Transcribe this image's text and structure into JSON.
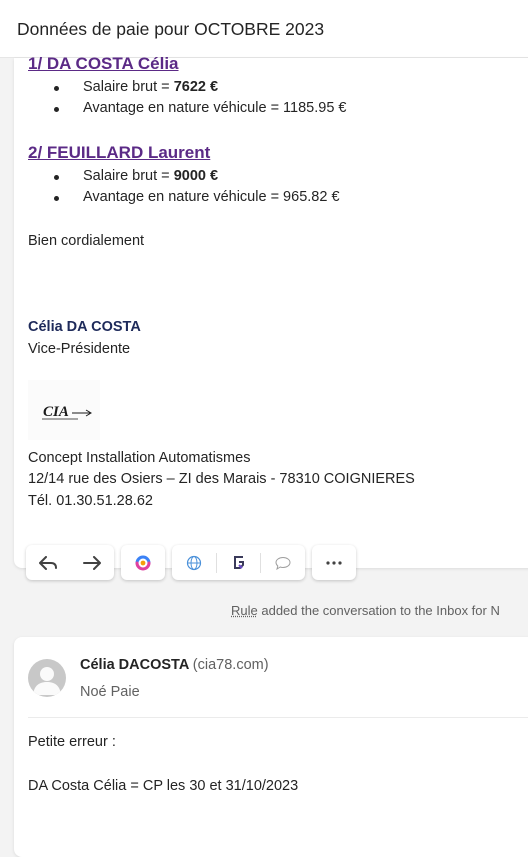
{
  "header": {
    "subject": "Données de paie pour OCTOBRE 2023"
  },
  "message1": {
    "person1": {
      "heading": "1/ DA COSTA Célia",
      "items": [
        {
          "prefix": "Salaire brut = ",
          "bold": "7622 €"
        },
        {
          "prefix": "Avantage en nature véhicule = 1185.95 €",
          "bold": ""
        }
      ]
    },
    "person2": {
      "heading": "2/ FEUILLARD Laurent",
      "items": [
        {
          "prefix": "Salaire brut = ",
          "bold": "9000 €"
        },
        {
          "prefix": "Avantage en nature véhicule = 965.82 €",
          "bold": ""
        }
      ]
    },
    "closing": "Bien cordialement",
    "signature": {
      "name": "Célia DA COSTA",
      "role": "Vice-Présidente",
      "logo_text": "CIA",
      "company": "Concept Installation Automatismes",
      "address": "12/14 rue des Osiers – ZI des Marais - 78310 COIGNIERES",
      "phone": "Tél. 01.30.51.28.62"
    }
  },
  "toolbar": {
    "icons": [
      "reply-icon",
      "forward-icon",
      "copilot-icon",
      "translate-icon",
      "app-icon",
      "comment-icon",
      "more-icon"
    ]
  },
  "rule_notice": {
    "rule_word": "Rule",
    "text": " added the conversation to the Inbox for N"
  },
  "message2": {
    "sender_name": "Célia DACOSTA",
    "sender_domain": "(cia78.com)",
    "to": "Noé Paie",
    "line1": "Petite erreur :",
    "line2": "DA Costa Célia = CP les 30 et 31/10/2023"
  }
}
